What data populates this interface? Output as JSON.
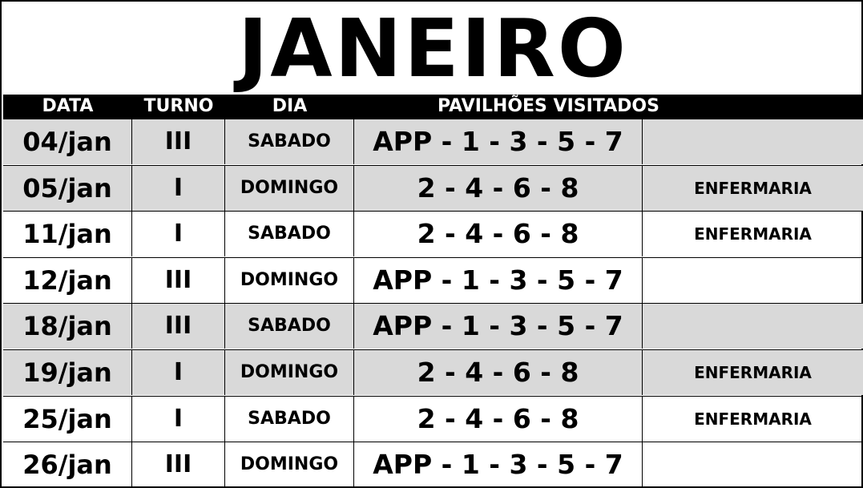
{
  "title": "JANEIRO",
  "headers": {
    "data": "DATA",
    "turno": "TURNO",
    "dia": "DIA",
    "pavilhoes": "PAVILHÕES VISITADOS"
  },
  "rows": [
    {
      "date": "04/jan",
      "turno": "III",
      "dia": "SABADO",
      "pavilhoes": "APP - 1 - 3 - 5 - 7",
      "extra": "",
      "shaded": true
    },
    {
      "date": "05/jan",
      "turno": "I",
      "dia": "DOMINGO",
      "pavilhoes": "2 - 4 - 6 - 8",
      "extra": "ENFERMARIA",
      "shaded": true
    },
    {
      "date": "11/jan",
      "turno": "I",
      "dia": "SABADO",
      "pavilhoes": "2 - 4 - 6 - 8",
      "extra": "ENFERMARIA",
      "shaded": false
    },
    {
      "date": "12/jan",
      "turno": "III",
      "dia": "DOMINGO",
      "pavilhoes": "APP - 1 - 3 - 5 - 7",
      "extra": "",
      "shaded": false
    },
    {
      "date": "18/jan",
      "turno": "III",
      "dia": "SABADO",
      "pavilhoes": "APP - 1 - 3 - 5 - 7",
      "extra": "",
      "shaded": true
    },
    {
      "date": "19/jan",
      "turno": "I",
      "dia": "DOMINGO",
      "pavilhoes": "2 - 4 - 6 - 8",
      "extra": "ENFERMARIA",
      "shaded": true
    },
    {
      "date": "25/jan",
      "turno": "I",
      "dia": "SABADO",
      "pavilhoes": "2 - 4 - 6 - 8",
      "extra": "ENFERMARIA",
      "shaded": false
    },
    {
      "date": "26/jan",
      "turno": "III",
      "dia": "DOMINGO",
      "pavilhoes": "APP - 1 - 3 - 5 - 7",
      "extra": "",
      "shaded": false
    }
  ],
  "colors": {
    "shaded_row": "#d9d9d9",
    "header_bg": "#000000",
    "header_text": "#ffffff"
  }
}
